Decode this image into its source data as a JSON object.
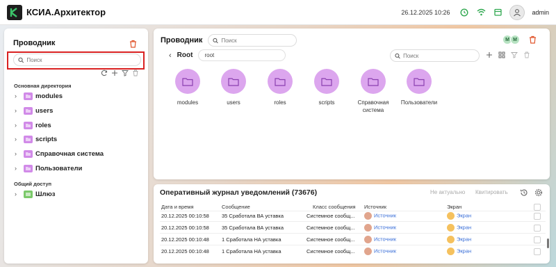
{
  "header": {
    "app_title": "КСИА.Архитектор",
    "datetime": "26.12.2025 10:26",
    "user": "admin",
    "icons": [
      "clock-icon",
      "wifi-icon",
      "calendar-icon",
      "user-icon"
    ],
    "accent_green": "#2fa84f"
  },
  "explorer": {
    "title": "Проводник",
    "search_placeholder": "Поиск",
    "sections": [
      {
        "label": "Основная директория",
        "items": [
          "modules",
          "users",
          "roles",
          "scripts",
          "Справочная система",
          "Пользователи"
        ]
      },
      {
        "label": "Общий доступ",
        "items": [
          "Шлюз"
        ]
      }
    ]
  },
  "main": {
    "title": "Проводник",
    "search_placeholder": "Поиск",
    "avatars": [
      "M",
      "M"
    ],
    "root_label": "Root",
    "path_value": "root",
    "right_search_placeholder": "Поиск",
    "folders": [
      "modules",
      "users",
      "roles",
      "scripts",
      "Справочная система",
      "Пользователи"
    ],
    "folder_color": "#dca6ee"
  },
  "log": {
    "title": "Оперативный журнал уведомлений (73676)",
    "btn_not_actual": "Не актуально",
    "btn_ack": "Квитировать",
    "columns": [
      "Дата и время",
      "Сообщение",
      "Класс сообщения",
      "Источник",
      "Экран"
    ],
    "rows": [
      {
        "time": "20.12.2025 00:10:58",
        "message": "35 Сработала ВА уставка",
        "class": "Системное сообщ...",
        "source": "Источник",
        "screen": "Экран"
      },
      {
        "time": "20.12.2025 00:10:58",
        "message": "35 Сработала ВА уставка",
        "class": "Системное сообщ...",
        "source": "Источник",
        "screen": "Экран"
      },
      {
        "time": "20.12.2025 00:10:48",
        "message": "1 Сработала НА уставка",
        "class": "Системное сообщ...",
        "source": "Источник",
        "screen": "Экран"
      },
      {
        "time": "20.12.2025 00:10:48",
        "message": "1 Сработала НА уставка",
        "class": "Системное сообщ...",
        "source": "Источник",
        "screen": "Экран"
      }
    ]
  }
}
